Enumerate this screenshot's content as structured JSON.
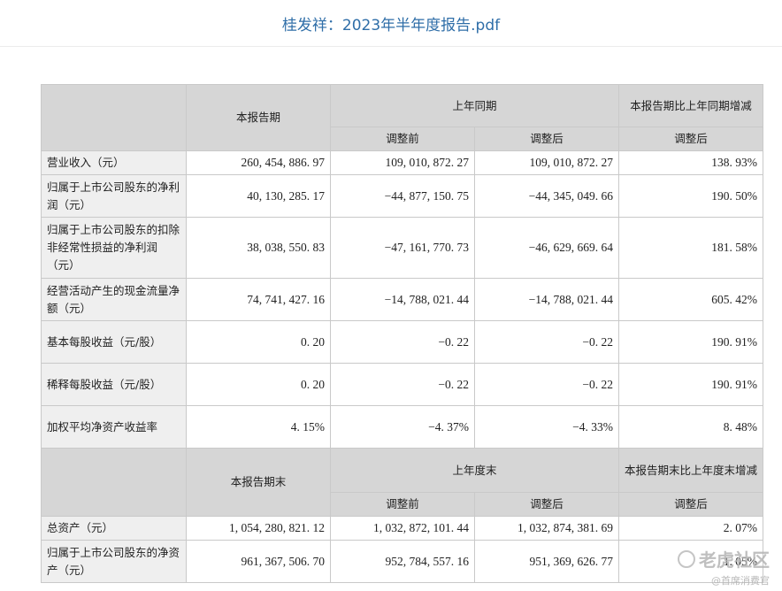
{
  "document": {
    "title": "桂发祥：2023年半年度报告.pdf"
  },
  "table": {
    "h_current": "本报告期",
    "h_last_period": "上年同期",
    "h_change": "本报告期比上年同期增减",
    "h_before_adj": "调整前",
    "h_after_adj": "调整后",
    "h_change_adj": "调整后",
    "rows": [
      {
        "label": "营业收入（元）",
        "current": "260, 454, 886. 97",
        "before": "109, 010, 872. 27",
        "after": "109, 010, 872. 27",
        "change": "138. 93%"
      },
      {
        "label": "归属于上市公司股东的净利润（元）",
        "current": "40, 130, 285. 17",
        "before": "−44, 877, 150. 75",
        "after": "−44, 345, 049. 66",
        "change": "190. 50%"
      },
      {
        "label": "归属于上市公司股东的扣除非经常性损益的净利润（元）",
        "current": "38, 038, 550. 83",
        "before": "−47, 161, 770. 73",
        "after": "−46, 629, 669. 64",
        "change": "181. 58%"
      },
      {
        "label": "经营活动产生的现金流量净额（元）",
        "current": "74, 741, 427. 16",
        "before": "−14, 788, 021. 44",
        "after": "−14, 788, 021. 44",
        "change": "605. 42%"
      },
      {
        "label": "基本每股收益（元/股）",
        "current": "0. 20",
        "before": "−0. 22",
        "after": "−0. 22",
        "change": "190. 91%"
      },
      {
        "label": "稀释每股收益（元/股）",
        "current": "0. 20",
        "before": "−0. 22",
        "after": "−0. 22",
        "change": "190. 91%"
      },
      {
        "label": "加权平均净资产收益率",
        "current": "4. 15%",
        "before": "−4. 37%",
        "after": "−4. 33%",
        "change": "8. 48%"
      }
    ],
    "h2_current": "本报告期末",
    "h2_last_period": "上年度末",
    "h2_change": "本报告期末比上年度末增减",
    "h2_before_adj": "调整前",
    "h2_after_adj": "调整后",
    "h2_change_adj": "调整后",
    "rows2": [
      {
        "label": "总资产（元）",
        "current": "1, 054, 280, 821. 12",
        "before": "1, 032, 872, 101. 44",
        "after": "1, 032, 874, 381. 69",
        "change": "2. 07%"
      },
      {
        "label": "归属于上市公司股东的净资产（元）",
        "current": "961, 367, 506. 70",
        "before": "952, 784, 557. 16",
        "after": "951, 369, 626. 77",
        "change": "1. 05%"
      }
    ]
  },
  "watermark": {
    "brand": "老虎社区",
    "handle": "@首席消费官"
  }
}
